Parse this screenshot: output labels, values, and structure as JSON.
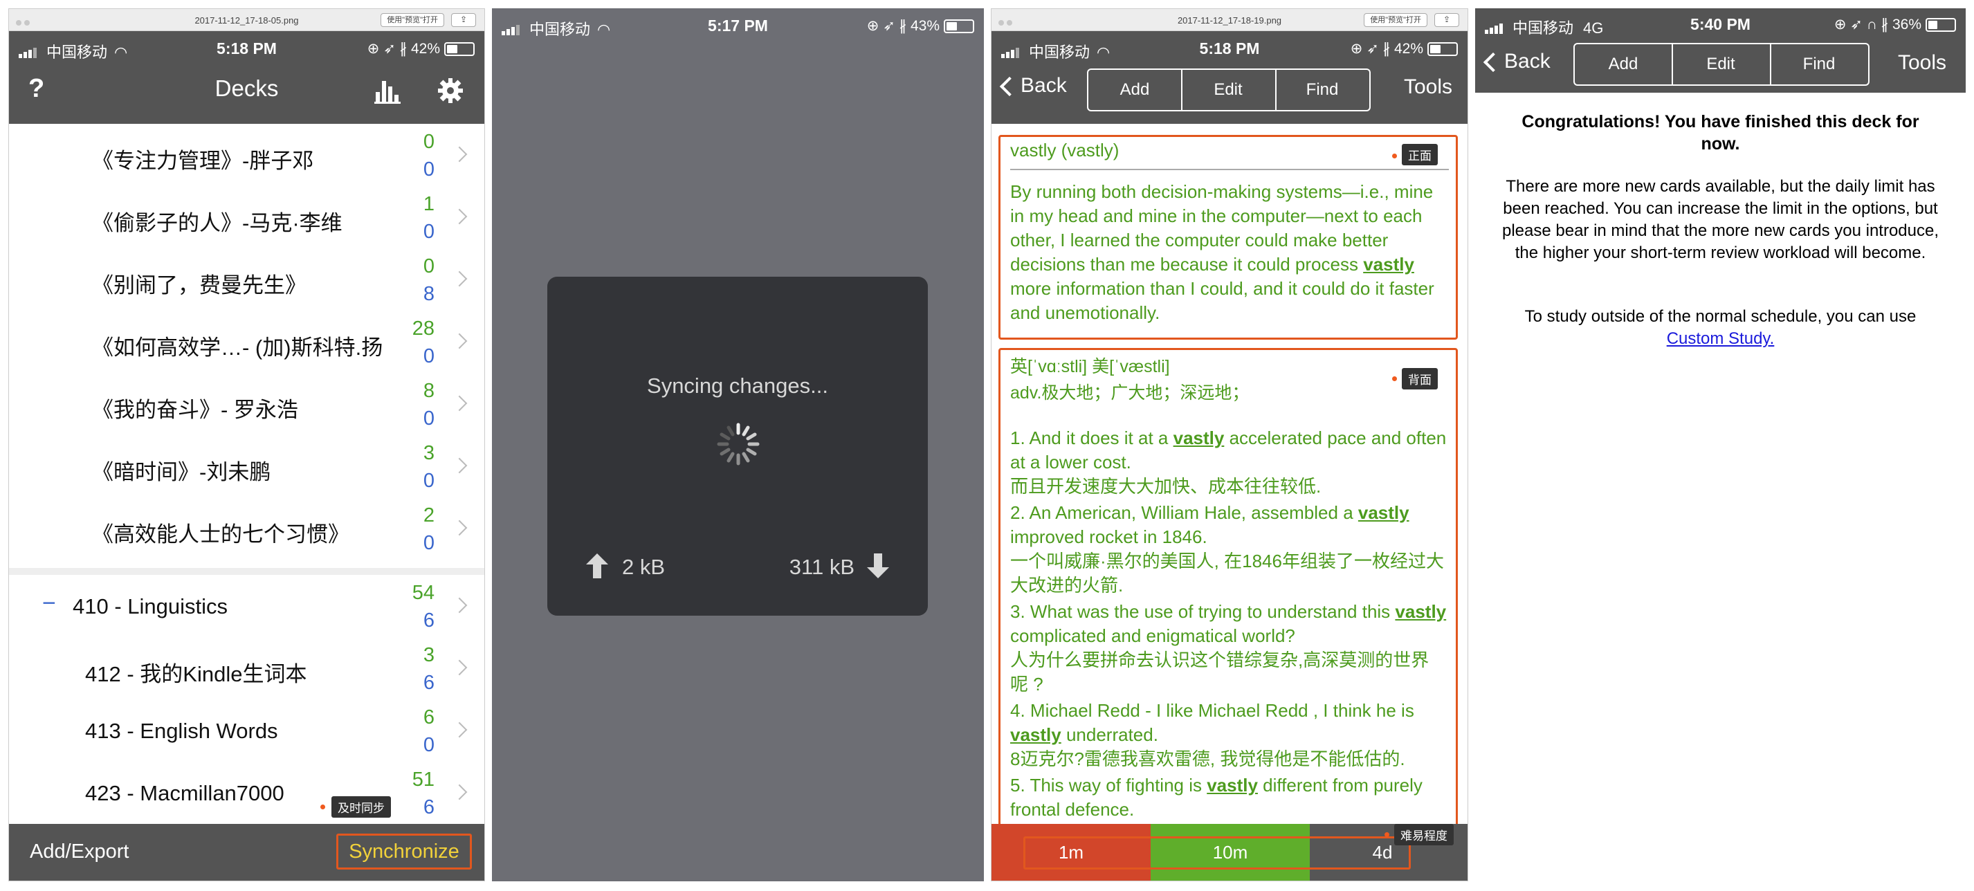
{
  "panel1": {
    "mac_filename": "2017-11-12_17-18-05.png",
    "mac_preview_button": "使用\"预览\"打开",
    "carrier": "中国移动",
    "time": "5:18 PM",
    "battery": "42%",
    "battery_level": 0.42,
    "help_label": "?",
    "title": "Decks",
    "decks": [
      {
        "title": "《专注力管理》-胖子邓",
        "new": "0",
        "due": "0"
      },
      {
        "title": "《偷影子的人》-马克·李维",
        "new": "1",
        "due": "0"
      },
      {
        "title": "《别闹了，费曼先生》",
        "new": "0",
        "due": "8"
      },
      {
        "title": "《如何高效学…- (加)斯科特.扬",
        "new": "28",
        "due": "0"
      },
      {
        "title": "《我的奋斗》- 罗永浩",
        "new": "8",
        "due": "0"
      },
      {
        "title": "《暗时间》-刘未鹏",
        "new": "3",
        "due": "0"
      },
      {
        "title": "《高效能人士的七个习惯》",
        "new": "2",
        "due": "0"
      }
    ],
    "group": {
      "collapse": "−",
      "title": "410 - Linguistics",
      "new": "54",
      "due": "6"
    },
    "subdecks": [
      {
        "title": "412 - 我的Kindle生词本",
        "new": "3",
        "due": "6"
      },
      {
        "title": "413 - English Words",
        "new": "6",
        "due": "0"
      },
      {
        "title": "423 - Macmillan7000",
        "new": "51",
        "due": "6"
      }
    ],
    "sync_tag": "及时同步",
    "add_export": "Add/Export",
    "synchronize": "Synchronize"
  },
  "panel2": {
    "carrier": "中国移动",
    "time": "5:17 PM",
    "battery": "43%",
    "battery_level": 0.43,
    "syncing": "Syncing changes...",
    "upload": "2 kB",
    "download": "311 kB"
  },
  "panel3": {
    "mac_filename": "2017-11-12_17-18-19.png",
    "mac_preview_button": "使用\"预览\"打开",
    "carrier": "中国移动",
    "time": "5:18 PM",
    "battery": "42%",
    "battery_level": 0.42,
    "back": "Back",
    "tabs": [
      "Add",
      "Edit",
      "Find"
    ],
    "tools": "Tools",
    "front_tag": "正面",
    "front_word": "vastly (vastly)",
    "front_sentence_a": "By running both decision-making systems—i.e., mine in my head and mine in the computer—next to each other, I learned the computer could make better decisions than me because it could process ",
    "front_bold": "vastly",
    "front_sentence_b": " more information than I could, and it could do it faster and unemotionally.",
    "back_tag": "背面",
    "phonetic": "英[ˈvɑːstli] 美[ˈvæstli]",
    "definition": "adv.极大地；广大地；深远地；",
    "examples": [
      {
        "a": "1. And it does it at a ",
        "bold": "vastly",
        "b": " accelerated pace and often at a lower cost.",
        "cn": "而且开发速度大大加快、成本往往较低."
      },
      {
        "a": "2. An American, William Hale, assembled a ",
        "bold": "vastly",
        "b": " improved rocket in 1846.",
        "cn": "一个叫威廉·黑尔的美国人, 在1846年组装了一枚经过大大改进的火箭."
      },
      {
        "a": "3. What was the use of trying to understand this ",
        "bold": "vastly",
        "b": " complicated and enigmatical world?",
        "cn": "人为什么要拼命去认识这个错综复杂,高深莫测的世界 呢 ?"
      },
      {
        "a": "4. Michael Redd - I like Michael Redd , I think he is ",
        "bold": "vastly",
        "b": " underrated.",
        "cn": "8迈克尔?雷德我喜欢雷德, 我觉得他是不能低估的."
      },
      {
        "a": "5. This way of fighting is ",
        "bold": "vastly",
        "b": " different from purely frontal defence.",
        "cn": ""
      }
    ],
    "difficulty_tag": "难易程度",
    "answer_buttons": [
      "1m",
      "10m",
      "4d"
    ]
  },
  "panel4": {
    "carrier": "中国移动",
    "network": "4G",
    "time": "5:40 PM",
    "battery": "36%",
    "battery_level": 0.36,
    "back": "Back",
    "tabs": [
      "Add",
      "Edit",
      "Find"
    ],
    "tools": "Tools",
    "congrats": "Congratulations! You have finished this deck for now.",
    "limit_text": "There are more new cards available, but the daily limit has been reached. You can increase the limit in the options, but please bear in mind that the more new cards you introduce, the higher your short-term review workload will become.",
    "study_text": "To study outside of the normal schedule, you can use",
    "custom_study": "Custom Study."
  },
  "colors": {
    "navbar": "#545454",
    "green": "#4d9b1e",
    "blue": "#3a66cc",
    "orange": "#e2571e",
    "again": "#d2462a",
    "good": "#5fae2b",
    "easy": "#565656",
    "sync_gray": "#6d6e74"
  }
}
